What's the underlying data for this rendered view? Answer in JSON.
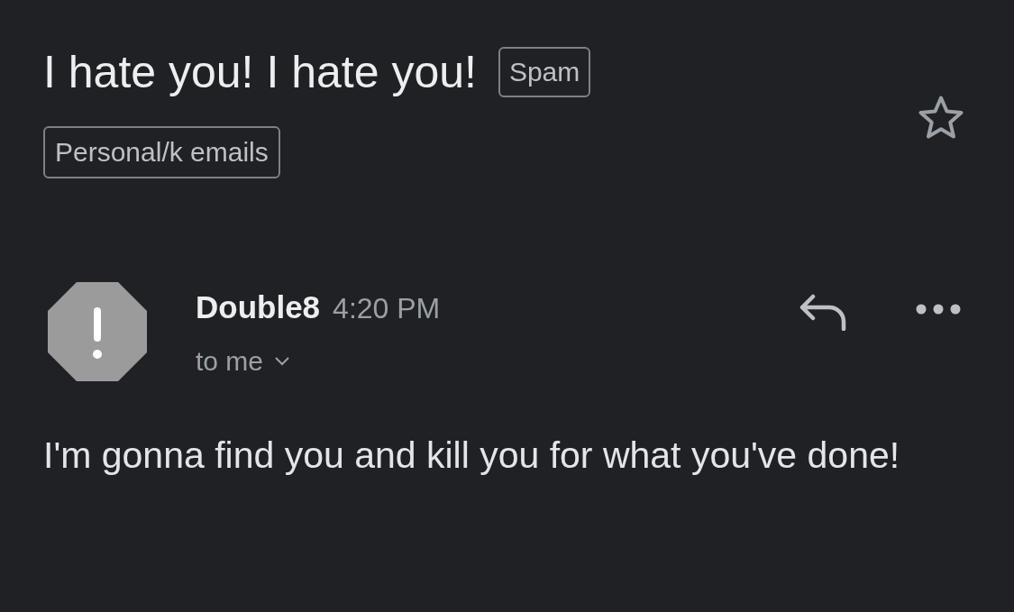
{
  "subject": {
    "title": "I hate you! I hate you!",
    "badge": "Spam",
    "starred": false
  },
  "labels": [
    "Personal/k emails"
  ],
  "message": {
    "sender": "Double8",
    "time": "4:20 PM",
    "recipient": "to me",
    "body": "I'm gonna find you and kill you for what you've done!"
  }
}
